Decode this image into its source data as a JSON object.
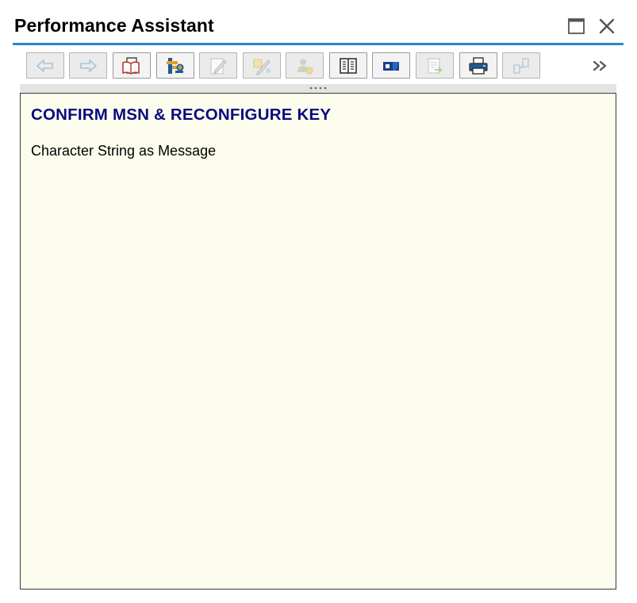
{
  "window": {
    "title": "Performance Assistant",
    "controls": [
      {
        "name": "maximize-icon"
      },
      {
        "name": "close-icon"
      }
    ],
    "accent_color": "#2a86c6"
  },
  "toolbar": {
    "buttons": [
      {
        "name": "back-button",
        "icon": "arrow-left-icon",
        "enabled": false
      },
      {
        "name": "forward-button",
        "icon": "arrow-right-icon",
        "enabled": false
      },
      {
        "name": "long-text-button",
        "icon": "open-book-icon",
        "enabled": true
      },
      {
        "name": "technical-info-button",
        "icon": "tools-icon",
        "enabled": true
      },
      {
        "name": "edit-button",
        "icon": "pencil-icon",
        "enabled": false
      },
      {
        "name": "annotate-button",
        "icon": "pen-note-icon",
        "enabled": false
      },
      {
        "name": "user-settings-button",
        "icon": "user-gear-icon",
        "enabled": false
      },
      {
        "name": "documentation-button",
        "icon": "book-icon",
        "enabled": true
      },
      {
        "name": "glossary-button",
        "icon": "glossary-icon",
        "enabled": true
      },
      {
        "name": "export-button",
        "icon": "document-arrow-icon",
        "enabled": false
      },
      {
        "name": "print-button",
        "icon": "printer-icon",
        "enabled": true
      },
      {
        "name": "structure-button",
        "icon": "hierarchy-icon",
        "enabled": false
      }
    ],
    "more_icon": "double-chevron-right-icon"
  },
  "content": {
    "heading": "CONFIRM MSN & RECONFIGURE KEY",
    "message": "Character String as Message",
    "background_color": "#fdfdee",
    "heading_color": "#0a0a82"
  }
}
